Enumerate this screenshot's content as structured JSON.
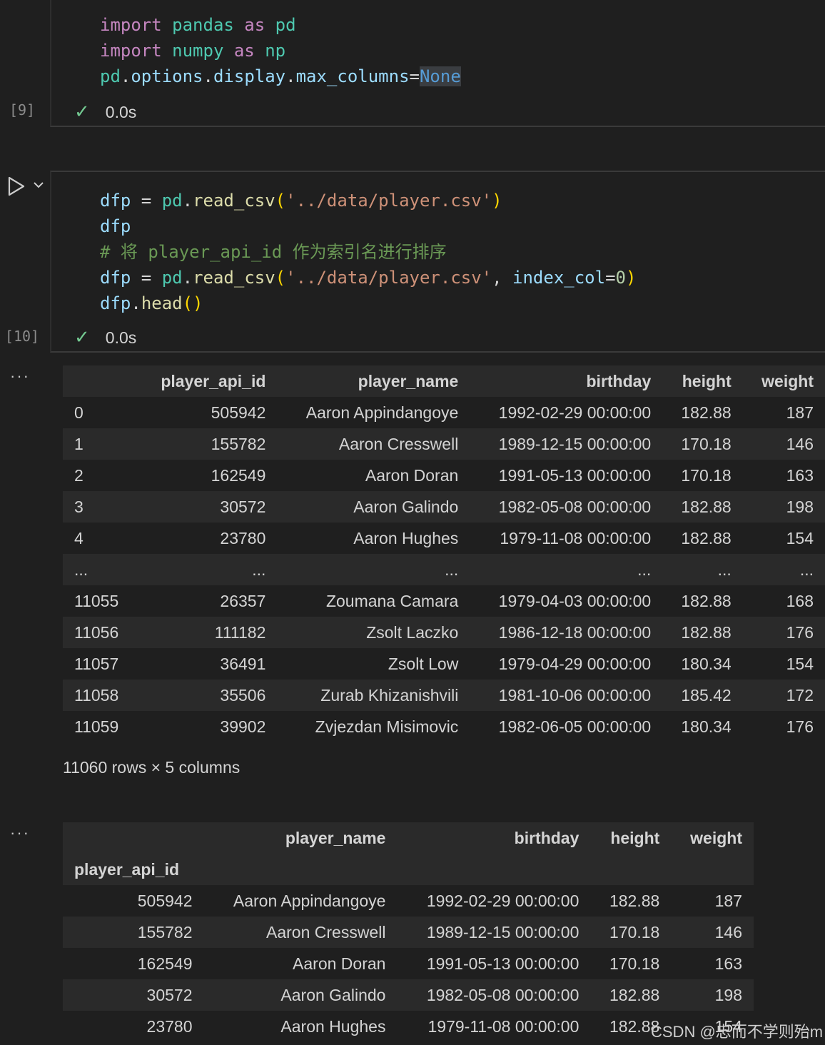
{
  "cell1": {
    "lines": [
      [
        {
          "t": "import",
          "c": "kw"
        },
        {
          "t": " pandas ",
          "c": "mod"
        },
        {
          "t": "as",
          "c": "kw"
        },
        {
          "t": " pd",
          "c": "mod"
        }
      ],
      [
        {
          "t": "import",
          "c": "kw"
        },
        {
          "t": " numpy ",
          "c": "mod"
        },
        {
          "t": "as",
          "c": "kw"
        },
        {
          "t": " np",
          "c": "mod"
        }
      ],
      [
        {
          "t": "pd",
          "c": "mod"
        },
        {
          "t": ".",
          "c": "op"
        },
        {
          "t": "options",
          "c": "var"
        },
        {
          "t": ".",
          "c": "op"
        },
        {
          "t": "display",
          "c": "var"
        },
        {
          "t": ".",
          "c": "op"
        },
        {
          "t": "max_columns",
          "c": "var"
        },
        {
          "t": "=",
          "c": "op"
        },
        {
          "t": "None",
          "c": "const"
        }
      ]
    ],
    "exec_count": "[9]",
    "duration": "0.0s"
  },
  "cell2": {
    "lines": [
      [
        {
          "t": "dfp",
          "c": "var"
        },
        {
          "t": " = ",
          "c": "op"
        },
        {
          "t": "pd",
          "c": "mod"
        },
        {
          "t": ".",
          "c": "op"
        },
        {
          "t": "read_csv",
          "c": "fn"
        },
        {
          "t": "(",
          "c": "par"
        },
        {
          "t": "'../data/player.csv'",
          "c": "str"
        },
        {
          "t": ")",
          "c": "par"
        }
      ],
      [
        {
          "t": "dfp",
          "c": "var"
        }
      ],
      [
        {
          "t": "# 将 player_api_id 作为索引名进行排序",
          "c": "cm"
        }
      ],
      [
        {
          "t": "dfp",
          "c": "var"
        },
        {
          "t": " = ",
          "c": "op"
        },
        {
          "t": "pd",
          "c": "mod"
        },
        {
          "t": ".",
          "c": "op"
        },
        {
          "t": "read_csv",
          "c": "fn"
        },
        {
          "t": "(",
          "c": "par"
        },
        {
          "t": "'../data/player.csv'",
          "c": "str"
        },
        {
          "t": ", ",
          "c": "op"
        },
        {
          "t": "index_col",
          "c": "var"
        },
        {
          "t": "=",
          "c": "op"
        },
        {
          "t": "0",
          "c": "num"
        },
        {
          "t": ")",
          "c": "par"
        }
      ],
      [
        {
          "t": "dfp",
          "c": "var"
        },
        {
          "t": ".",
          "c": "op"
        },
        {
          "t": "head",
          "c": "fn"
        },
        {
          "t": "()",
          "c": "par"
        }
      ]
    ],
    "exec_count": "[10]",
    "duration": "0.0s"
  },
  "output1": {
    "columns": [
      "",
      "player_api_id",
      "player_name",
      "birthday",
      "height",
      "weight"
    ],
    "rows": [
      [
        "0",
        "505942",
        "Aaron Appindangoye",
        "1992-02-29 00:00:00",
        "182.88",
        "187"
      ],
      [
        "1",
        "155782",
        "Aaron Cresswell",
        "1989-12-15 00:00:00",
        "170.18",
        "146"
      ],
      [
        "2",
        "162549",
        "Aaron Doran",
        "1991-05-13 00:00:00",
        "170.18",
        "163"
      ],
      [
        "3",
        "30572",
        "Aaron Galindo",
        "1982-05-08 00:00:00",
        "182.88",
        "198"
      ],
      [
        "4",
        "23780",
        "Aaron Hughes",
        "1979-11-08 00:00:00",
        "182.88",
        "154"
      ],
      [
        "...",
        "...",
        "...",
        "...",
        "...",
        "..."
      ],
      [
        "11055",
        "26357",
        "Zoumana Camara",
        "1979-04-03 00:00:00",
        "182.88",
        "168"
      ],
      [
        "11056",
        "111182",
        "Zsolt Laczko",
        "1986-12-18 00:00:00",
        "182.88",
        "176"
      ],
      [
        "11057",
        "36491",
        "Zsolt Low",
        "1979-04-29 00:00:00",
        "180.34",
        "154"
      ],
      [
        "11058",
        "35506",
        "Zurab Khizanishvili",
        "1981-10-06 00:00:00",
        "185.42",
        "172"
      ],
      [
        "11059",
        "39902",
        "Zvjezdan Misimovic",
        "1982-06-05 00:00:00",
        "180.34",
        "176"
      ]
    ],
    "shape": "11060 rows × 5 columns"
  },
  "output2": {
    "columns": [
      "",
      "player_name",
      "birthday",
      "height",
      "weight"
    ],
    "index_name": "player_api_id",
    "rows": [
      [
        "505942",
        "Aaron Appindangoye",
        "1992-02-29 00:00:00",
        "182.88",
        "187"
      ],
      [
        "155782",
        "Aaron Cresswell",
        "1989-12-15 00:00:00",
        "170.18",
        "146"
      ],
      [
        "162549",
        "Aaron Doran",
        "1991-05-13 00:00:00",
        "170.18",
        "163"
      ],
      [
        "30572",
        "Aaron Galindo",
        "1982-05-08 00:00:00",
        "182.88",
        "198"
      ],
      [
        "23780",
        "Aaron Hughes",
        "1979-11-08 00:00:00",
        "182.88",
        "154"
      ]
    ]
  },
  "more_dots": "···",
  "watermark": "CSDN @忠而不学则殆m",
  "icons": {
    "run": "play-icon",
    "check": "check-icon",
    "chevron": "chevron-down-icon"
  },
  "colors": {
    "background": "#1f1f1f",
    "check": "#73c991",
    "keyword": "#c586c0",
    "module": "#4ec9b0"
  }
}
